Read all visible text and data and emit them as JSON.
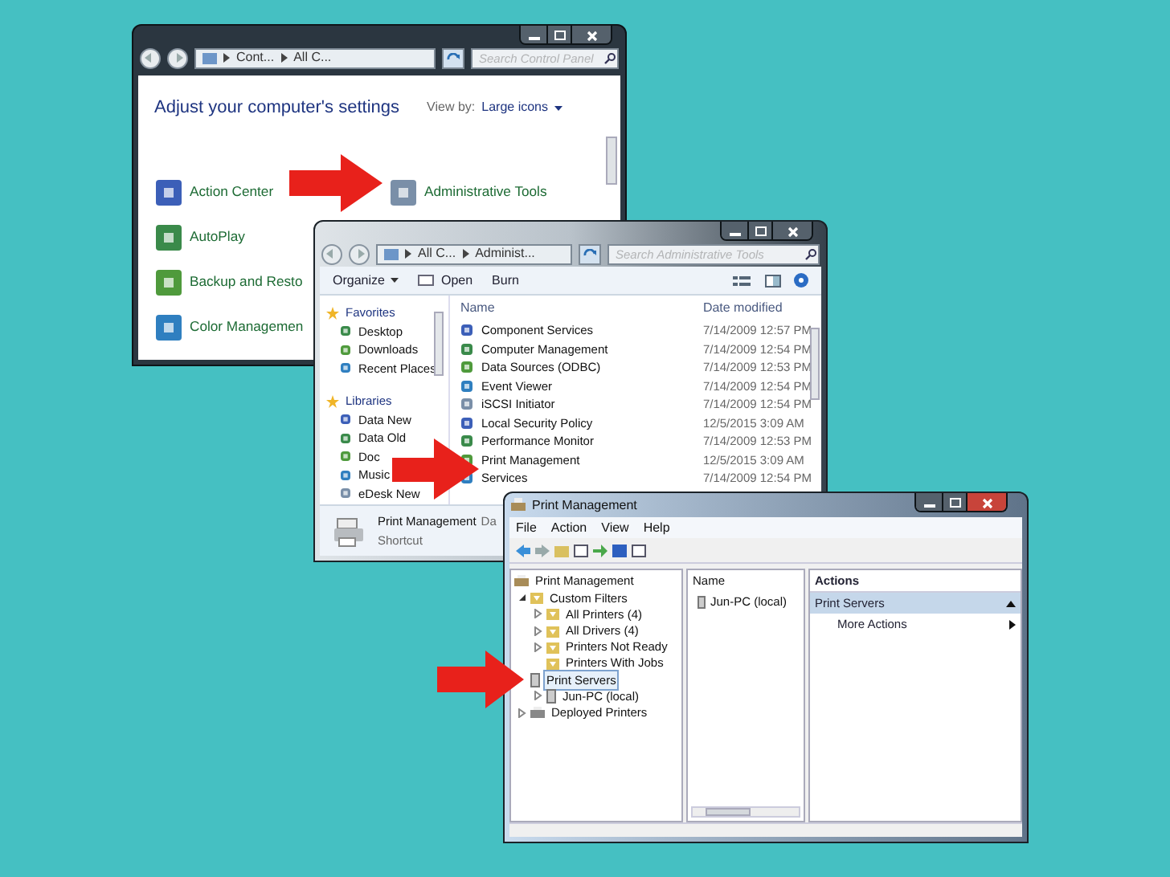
{
  "control_panel": {
    "breadcrumbs": [
      "Cont...",
      "All C..."
    ],
    "search": {
      "placeholder": "Search Control Panel"
    },
    "heading": "Adjust your computer's settings",
    "view_by_label": "View by:",
    "view_by_value": "Large icons",
    "columns": [
      [
        {
          "label": "Action Center"
        },
        {
          "label": "AutoPlay"
        },
        {
          "label": "Backup and Resto"
        },
        {
          "label": "Color Managemen"
        }
      ],
      [
        {
          "label": "Administrative Tools"
        }
      ]
    ]
  },
  "administrative_tools": {
    "breadcrumbs": [
      "All C...",
      "Administ..."
    ],
    "search": {
      "placeholder": "Search Administrative Tools"
    },
    "toolbar": [
      {
        "label": "Organize",
        "kind": "menu"
      },
      {
        "label": "Open",
        "kind": "open"
      },
      {
        "label": "Burn",
        "kind": "plain"
      }
    ],
    "navigation": [
      {
        "label": "Favorites",
        "kind": "group"
      },
      {
        "label": "Desktop",
        "kind": "item"
      },
      {
        "label": "Downloads",
        "kind": "item"
      },
      {
        "label": "Recent Places",
        "kind": "item"
      },
      {
        "label": "Libraries",
        "kind": "group"
      },
      {
        "label": "Data New",
        "kind": "item"
      },
      {
        "label": "Data Old",
        "kind": "item"
      },
      {
        "label": "Doc",
        "kind": "item"
      },
      {
        "label": "Music",
        "kind": "item"
      },
      {
        "label": "eDesk New",
        "kind": "item"
      }
    ],
    "columns": [
      "Name",
      "Date modified"
    ],
    "rows": [
      {
        "name": "Component Services",
        "date": "7/14/2009 12:57 PM"
      },
      {
        "name": "Computer Management",
        "date": "7/14/2009 12:54 PM"
      },
      {
        "name": "Data Sources (ODBC)",
        "date": "7/14/2009 12:53 PM"
      },
      {
        "name": "Event Viewer",
        "date": "7/14/2009 12:54 PM"
      },
      {
        "name": "iSCSI Initiator",
        "date": "7/14/2009 12:54 PM"
      },
      {
        "name": "Local Security Policy",
        "date": "12/5/2015 3:09 AM"
      },
      {
        "name": "Performance Monitor",
        "date": "7/14/2009 12:53 PM"
      },
      {
        "name": "Print Management",
        "date": "12/5/2015 3:09 AM"
      },
      {
        "name": "Services",
        "date": "7/14/2009 12:54 PM"
      }
    ],
    "details": {
      "name": "Print Management",
      "field": "Da",
      "type": "Shortcut"
    }
  },
  "print_management": {
    "title": "Print Management",
    "menu": [
      "File",
      "Action",
      "View",
      "Help"
    ],
    "tree": [
      {
        "label": "Print Management",
        "kind": "root",
        "selected": false,
        "children": [
          {
            "label": "Custom Filters",
            "kind": "filter",
            "selected": false,
            "expanded": true,
            "children": [
              {
                "label": "All Printers (4)",
                "kind": "filter",
                "selected": false,
                "expanded": false
              },
              {
                "label": "All Drivers (4)",
                "kind": "filter",
                "selected": false,
                "expanded": false
              },
              {
                "label": "Printers Not Ready",
                "kind": "filter",
                "selected": false,
                "expanded": false
              },
              {
                "label": "Printers With Jobs",
                "kind": "filter",
                "selected": false
              }
            ]
          },
          {
            "label": "Print Servers",
            "kind": "server",
            "selected": true,
            "children": [
              {
                "label": "Jun-PC (local)",
                "kind": "server",
                "selected": false,
                "expanded": false
              }
            ]
          },
          {
            "label": "Deployed Printers",
            "kind": "printers",
            "selected": false,
            "expanded": false
          }
        ]
      }
    ],
    "list_column": "Name",
    "list_items": [
      "Jun-PC (local)"
    ],
    "actions_title": "Actions",
    "actions": [
      {
        "label": "Print Servers",
        "kind": "header"
      },
      {
        "label": "More Actions",
        "kind": "submenu"
      }
    ]
  }
}
